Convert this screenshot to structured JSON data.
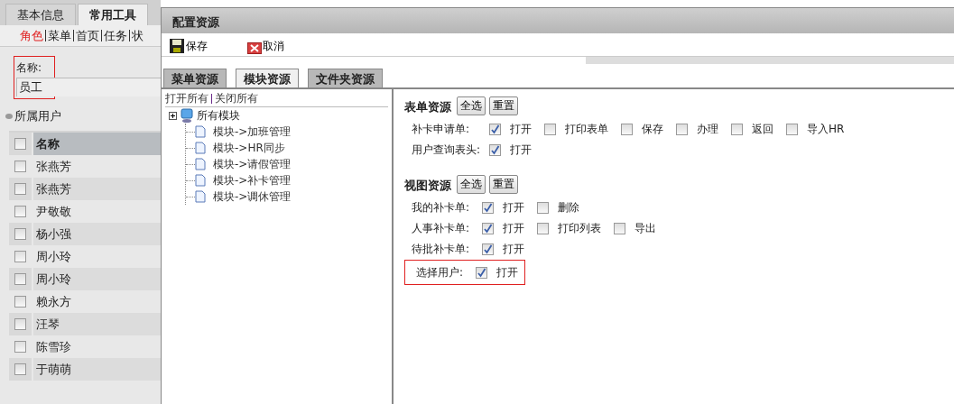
{
  "left_panel": {
    "tabs": [
      {
        "label": "基本信息",
        "selected": false
      },
      {
        "label": "常用工具",
        "selected": true
      }
    ],
    "nav_links": [
      {
        "label": "角色",
        "selected": true
      },
      {
        "label": "菜单",
        "selected": false
      },
      {
        "label": "首页",
        "selected": false
      },
      {
        "label": "任务",
        "selected": false
      },
      {
        "label": "状",
        "selected": false
      }
    ],
    "name_field": {
      "label": "名称:",
      "value": "员工",
      "highlighted": true
    },
    "section_title": "所属用户",
    "table": {
      "columns": [
        "名称"
      ],
      "header_checked": false,
      "rows": [
        {
          "name": "张燕芳",
          "checked": false
        },
        {
          "name": "张燕芳",
          "checked": false
        },
        {
          "name": "尹敬敬",
          "checked": false
        },
        {
          "name": "杨小强",
          "checked": false
        },
        {
          "name": "周小玲",
          "checked": false
        },
        {
          "name": "周小玲",
          "checked": false
        },
        {
          "name": "赖永方",
          "checked": false
        },
        {
          "name": "汪琴",
          "checked": false
        },
        {
          "name": "陈雪珍",
          "checked": false
        },
        {
          "name": "于萌萌",
          "checked": false
        }
      ]
    }
  },
  "dialog": {
    "title": "配置资源",
    "toolbar": [
      {
        "kind": "save",
        "label": "保存"
      },
      {
        "kind": "cancel",
        "label": "取消"
      }
    ],
    "tabs": [
      {
        "label": "菜单资源",
        "selected": false
      },
      {
        "label": "模块资源",
        "selected": true
      },
      {
        "label": "文件夹资源",
        "selected": false
      }
    ],
    "tree": {
      "expand_all": "打开所有",
      "collapse_all": "关闭所有",
      "root": {
        "label": "所有模块",
        "children": [
          {
            "label": "模块->加班管理"
          },
          {
            "label": "模块->HR同步"
          },
          {
            "label": "模块->请假管理"
          },
          {
            "label": "模块->补卡管理"
          },
          {
            "label": "模块->调休管理"
          }
        ]
      }
    },
    "sections": [
      {
        "title": "表单资源",
        "buttons": [
          "全选",
          "重置"
        ],
        "rows": [
          {
            "label": "补卡申请单:",
            "highlighted": false,
            "options": [
              {
                "label": "打开",
                "checked": true
              },
              {
                "label": "打印表单",
                "checked": false
              },
              {
                "label": "保存",
                "checked": false
              },
              {
                "label": "办理",
                "checked": false
              },
              {
                "label": "返回",
                "checked": false
              },
              {
                "label": "导入HR",
                "checked": false
              }
            ]
          },
          {
            "label": "用户查询表头:",
            "highlighted": false,
            "options": [
              {
                "label": "打开",
                "checked": true
              }
            ]
          }
        ]
      },
      {
        "title": "视图资源",
        "buttons": [
          "全选",
          "重置"
        ],
        "rows": [
          {
            "label": "我的补卡单:",
            "highlighted": false,
            "options": [
              {
                "label": "打开",
                "checked": true
              },
              {
                "label": "删除",
                "checked": false
              }
            ]
          },
          {
            "label": "人事补卡单:",
            "highlighted": false,
            "options": [
              {
                "label": "打开",
                "checked": true
              },
              {
                "label": "打印列表",
                "checked": false
              },
              {
                "label": "导出",
                "checked": false
              }
            ]
          },
          {
            "label": "待批补卡单:",
            "highlighted": false,
            "options": [
              {
                "label": "打开",
                "checked": true
              }
            ]
          },
          {
            "label": "选择用户:",
            "highlighted": true,
            "options": [
              {
                "label": "打开",
                "checked": true
              }
            ]
          }
        ]
      }
    ]
  }
}
